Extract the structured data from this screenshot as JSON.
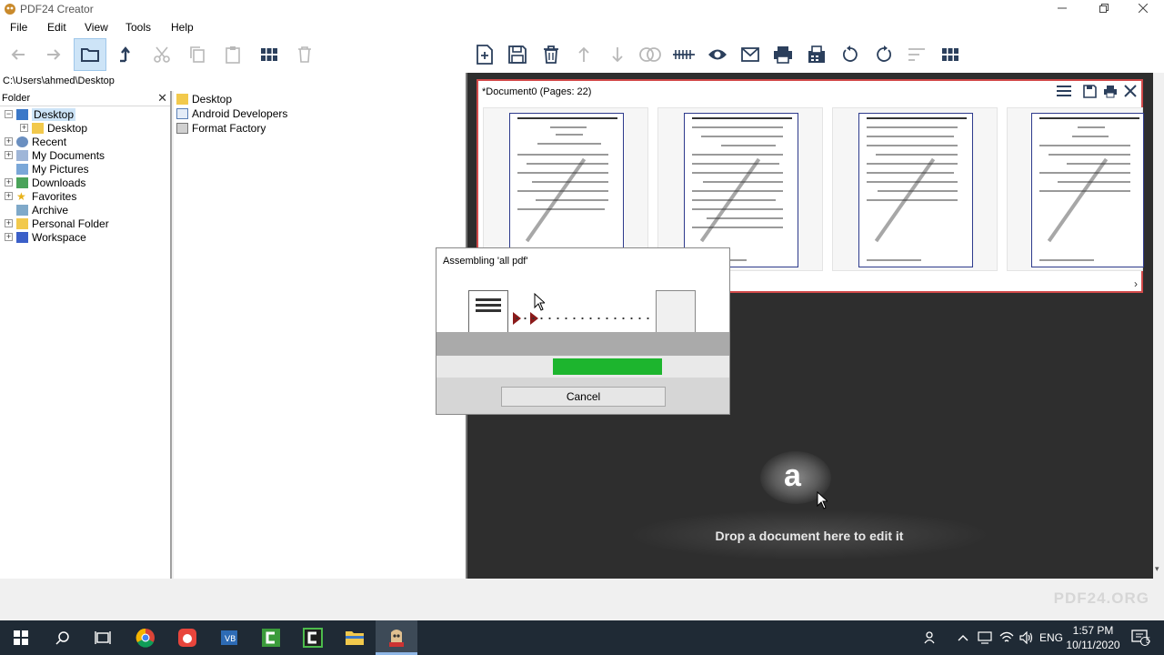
{
  "window": {
    "title": "PDF24 Creator",
    "minimize_icon": "minimize-icon",
    "maximize_icon": "restore-icon",
    "close_icon": "close-icon"
  },
  "menu": [
    "File",
    "Edit",
    "View",
    "Tools",
    "Help"
  ],
  "path": "C:\\Users\\ahmed\\Desktop",
  "folder_pane": {
    "title": "Folder",
    "tree": [
      {
        "label": "Desktop",
        "expander": "−",
        "icon": "desktop-folder-icon",
        "selected": true
      },
      {
        "label": "Desktop",
        "expander": "+",
        "icon": "folder-icon",
        "child": true
      },
      {
        "label": "Recent",
        "expander": "+",
        "icon": "recent-icon"
      },
      {
        "label": "My Documents",
        "expander": "+",
        "icon": "documents-icon"
      },
      {
        "label": "My Pictures",
        "expander": "",
        "icon": "pictures-icon"
      },
      {
        "label": "Downloads",
        "expander": "+",
        "icon": "downloads-icon"
      },
      {
        "label": "Favorites",
        "expander": "+",
        "icon": "star-icon"
      },
      {
        "label": "Archive",
        "expander": "",
        "icon": "archive-icon"
      },
      {
        "label": "Personal Folder",
        "expander": "+",
        "icon": "folder-icon"
      },
      {
        "label": "Workspace",
        "expander": "+",
        "icon": "workspace-icon"
      }
    ]
  },
  "files": [
    {
      "label": "Desktop",
      "icon": "folder-icon"
    },
    {
      "label": "Android Developers",
      "icon": "shortcut-icon"
    },
    {
      "label": "Format Factory",
      "icon": "app-shortcut-icon"
    }
  ],
  "document": {
    "title": "*Document0 (Pages: 22)"
  },
  "drop_hint": "Drop a document here to edit it",
  "dialog": {
    "title": "Assembling 'all pdf'",
    "cancel_label": "Cancel",
    "progress_color": "#1db52e"
  },
  "brand": "PDF24.ORG",
  "taskbar": {
    "language": "ENG",
    "time": "1:57 PM",
    "date": "10/11/2020",
    "notification_count": "5"
  },
  "colors": {
    "accent_selection": "#cde4f7",
    "doc_border": "#d24a4a",
    "editor_bg": "#2e2e2e",
    "taskbar_bg": "#1f2a35"
  }
}
